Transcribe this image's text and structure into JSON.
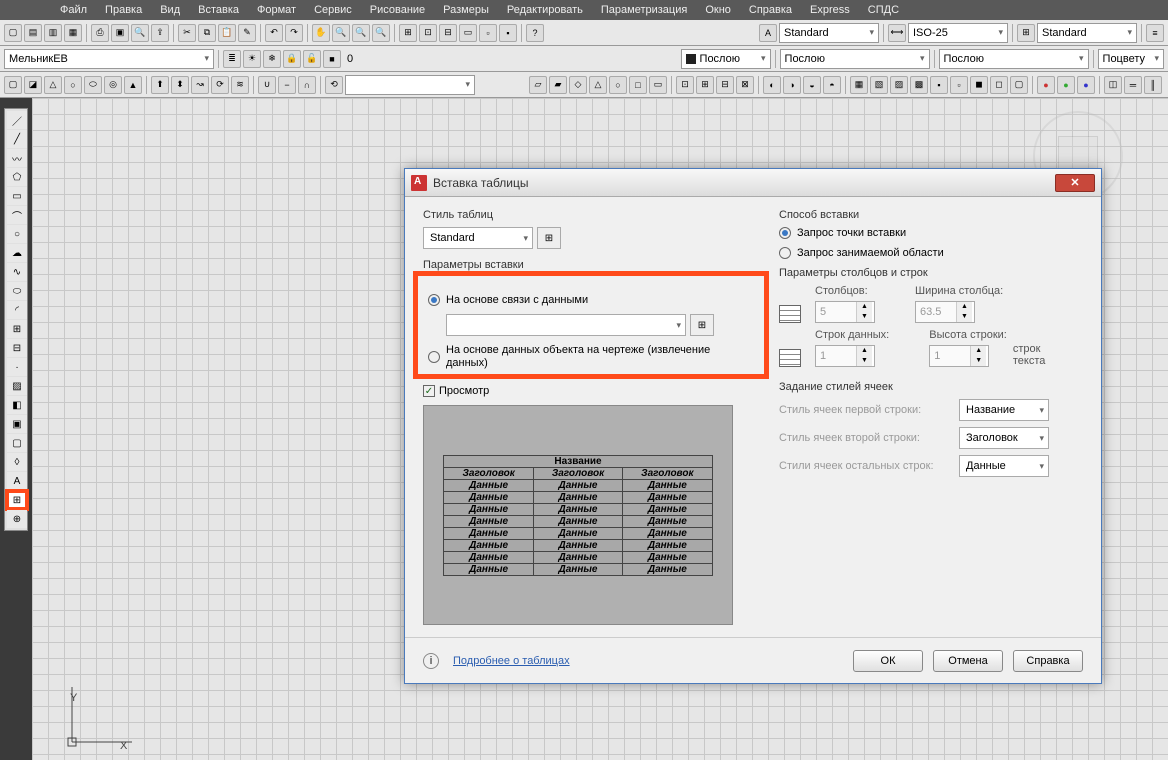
{
  "menu": [
    "Файл",
    "Правка",
    "Вид",
    "Вставка",
    "Формат",
    "Сервис",
    "Рисование",
    "Размеры",
    "Редактировать",
    "Параметризация",
    "Окно",
    "Справка",
    "Express",
    "СПДС"
  ],
  "toolbar": {
    "layer_combo": "МельникЕВ",
    "zero": "0",
    "std1": "Standard",
    "iso": "ISO-25",
    "std2": "Standard",
    "bylayer": "Послою",
    "bycolor": "Поцвету"
  },
  "dialog": {
    "title": "Вставка таблицы",
    "table_style_label": "Стиль таблиц",
    "table_style_value": "Standard",
    "insert_params_label": "Параметры вставки",
    "radio_data_link": "На основе связи с данными",
    "radio_drawing_obj": "На основе данных объекта на чертеже (извлечение данных)",
    "preview_check": "Просмотр",
    "insert_method_label": "Способ вставки",
    "radio_point": "Запрос точки вставки",
    "radio_area": "Запрос занимаемой области",
    "col_row_label": "Параметры столбцов и строк",
    "cols_label": "Столбцов:",
    "cols_value": "5",
    "colw_label": "Ширина столбца:",
    "colw_value": "63.5",
    "rows_label": "Строк данных:",
    "rows_value": "1",
    "rowh_label": "Высота строки:",
    "rowh_value": "1",
    "rowh_unit": "строк\nтекста",
    "cell_styles_label": "Задание стилей ячеек",
    "cs_first": "Стиль ячеек первой строки:",
    "cs_first_val": "Название",
    "cs_second": "Стиль ячеек второй строки:",
    "cs_second_val": "Заголовок",
    "cs_other": "Стили ячеек остальных строк:",
    "cs_other_val": "Данные",
    "more_link": "Подробнее о таблицах",
    "ok": "ОК",
    "cancel": "Отмена",
    "help": "Справка",
    "preview": {
      "title": "Название",
      "header": "Заголовок",
      "data": "Данные"
    }
  },
  "axes": {
    "x": "X",
    "y": "Y"
  }
}
